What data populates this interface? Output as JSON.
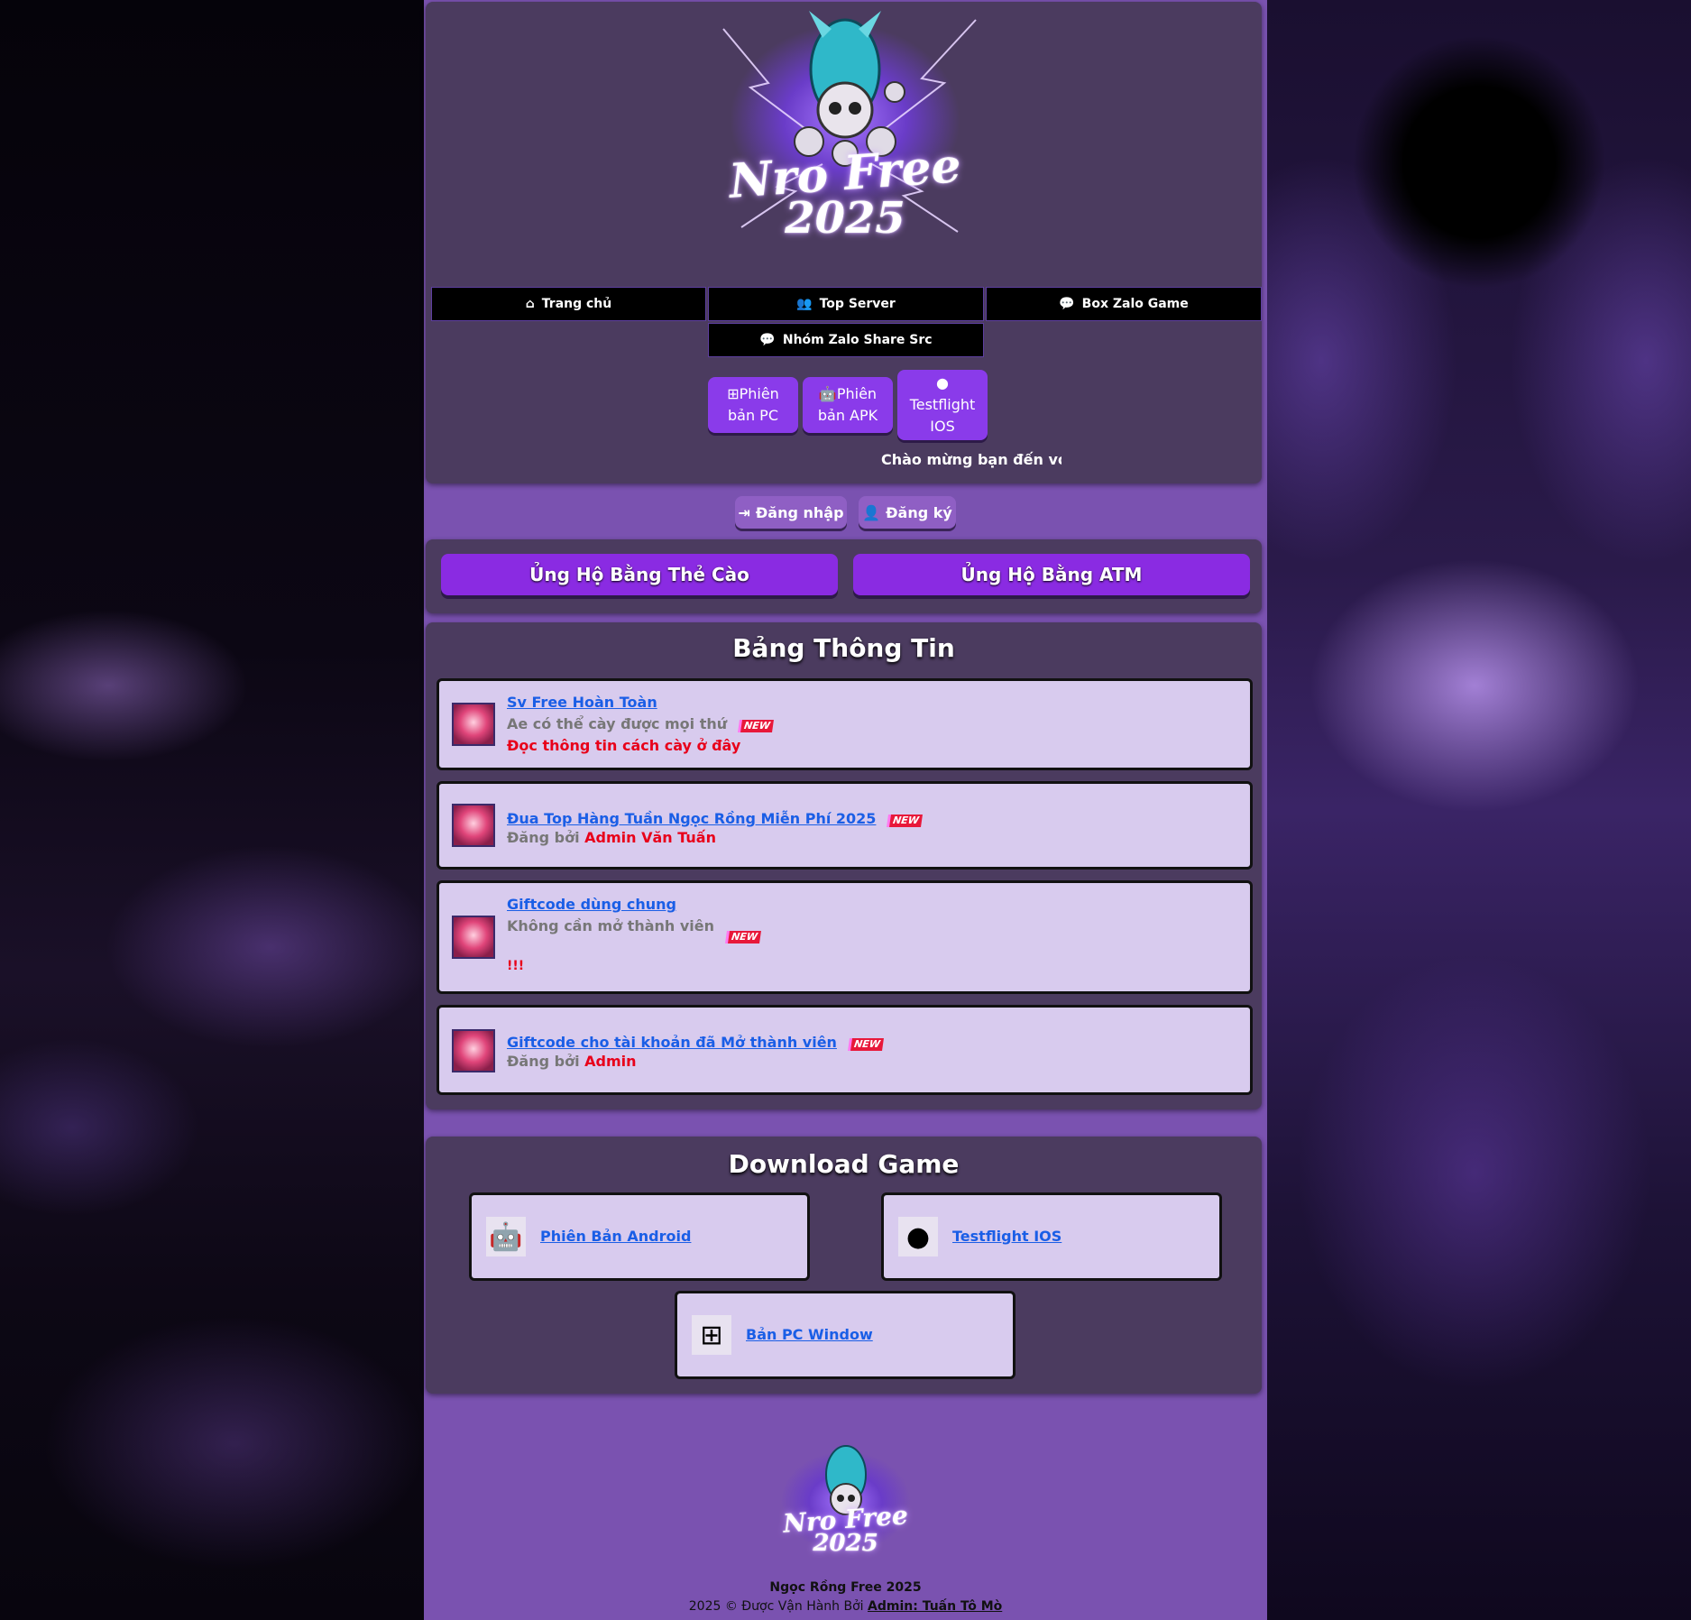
{
  "header": {
    "logo_line1": "Nro Free",
    "logo_line2": "2025"
  },
  "nav": {
    "home": "Trang chủ",
    "top_server": "Top Server",
    "box_zalo": "Box Zalo Game",
    "share_src": "Nhóm Zalo Share Src"
  },
  "versions": {
    "pc_line1": "Phiên",
    "pc_line2": "bản PC",
    "apk_line1": "Phiên",
    "apk_line2": "bản APK",
    "ios_line1": "Testflight",
    "ios_line2": "IOS"
  },
  "marquee": "Chào mừng bạn đến với N",
  "auth": {
    "login": "Đăng nhập",
    "register": "Đăng ký"
  },
  "support": {
    "card": "Ủng Hộ Bằng Thẻ Cào",
    "atm": "Ủng Hộ Bằng ATM"
  },
  "info": {
    "title": "Bảng Thông Tin",
    "posts": [
      {
        "title": "Sv Free Hoàn Toàn",
        "line1": "Ae có thể cày được mọi thứ",
        "line2": "Đọc thông tin cách cày ở đây",
        "badge": "NEW"
      },
      {
        "title": "Đua Top Hàng Tuần Ngọc Rồng Miễn Phí 2025",
        "by_prefix": "Đăng bởi",
        "by_name": "Admin Văn Tuấn",
        "badge": "NEW"
      },
      {
        "title": "Giftcode dùng chung",
        "line1": "Không cần mở thành viên",
        "line3": "!!!",
        "badge": "NEW"
      },
      {
        "title": "Giftcode cho tài khoản đã Mở thành viên",
        "by_prefix": "Đăng bởi",
        "by_name": "Admin",
        "badge": "NEW"
      }
    ]
  },
  "download": {
    "title": "Download Game",
    "android": "Phiên Bản Android",
    "ios": "Testflight IOS",
    "pc": "Bản PC Window"
  },
  "footer": {
    "logo_line1": "Nro Free",
    "logo_line2": "2025",
    "name": "Ngọc Rồng Free 2025",
    "copyright": "2025 © Được Vận Hành Bởi",
    "admin_link": "Admin: Tuấn Tô Mò"
  },
  "colors": {
    "page_bg": "#7a52b0",
    "card_bg": "#4b3b5f",
    "accent": "#8a2be2",
    "link": "#1a5ee6",
    "alert_red": "#e8001a"
  }
}
